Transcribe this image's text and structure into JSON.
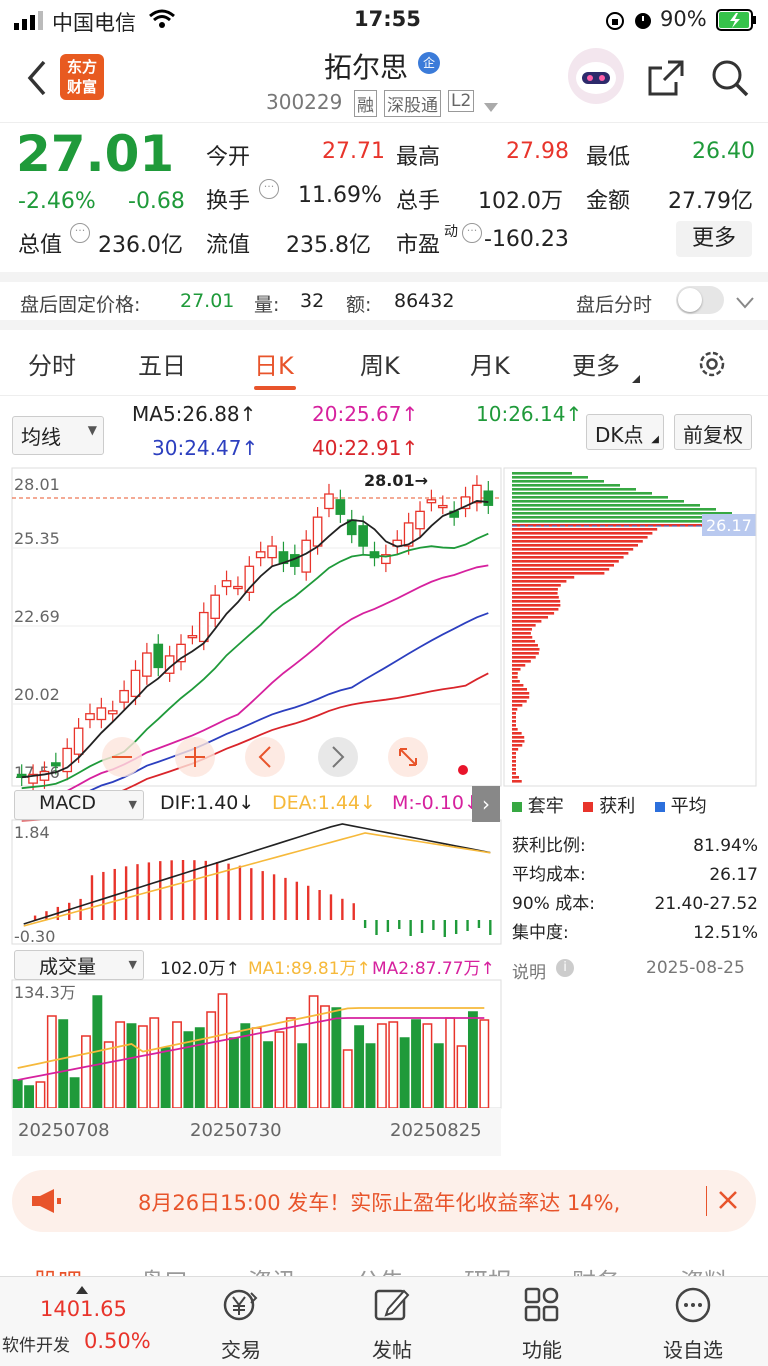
{
  "status": {
    "carrier": "中国电信",
    "time": "17:55",
    "battery": "90%"
  },
  "header": {
    "name": "拓尔思",
    "badge": "企",
    "code": "300229",
    "tags": [
      "融",
      "深股通",
      "L2"
    ],
    "logo_line1": "东方",
    "logo_line2": "财富"
  },
  "quote": {
    "price": "27.01",
    "pct": "-2.46%",
    "chg": "-0.68",
    "row1": [
      {
        "label": "今开",
        "value": "27.71",
        "color": "red"
      },
      {
        "label": "最高",
        "value": "27.98",
        "color": "red"
      },
      {
        "label": "最低",
        "value": "26.40",
        "color": "green"
      }
    ],
    "row2": [
      {
        "label": "换手",
        "value": "11.69%"
      },
      {
        "label": "总手",
        "value": "102.0万"
      },
      {
        "label": "金额",
        "value": "27.79亿"
      }
    ],
    "row3_total_label": "总值",
    "row3_total_value": "236.0亿",
    "row3_float_label": "流值",
    "row3_float_value": "235.8亿",
    "row3_pe_label": "市盈",
    "row3_pe_sup": "动",
    "row3_pe_value": "-160.23",
    "more": "更多"
  },
  "afterhours": {
    "label": "盘后固定价格:",
    "price": "27.01",
    "vol_label": "量:",
    "vol": "32",
    "amt_label": "额:",
    "amt": "86432",
    "toggle_label": "盘后分时"
  },
  "tabs": [
    "分时",
    "五日",
    "日K",
    "周K",
    "月K",
    "更多"
  ],
  "active_tab": 2,
  "ma": {
    "selector": "均线",
    "ma5": "MA5:26.88↑",
    "ma10": "10:26.14↑",
    "ma20": "20:25.67↑",
    "ma30": "30:24.47↑",
    "ma40": "40:22.91↑",
    "dk": "DK点",
    "adjust": "前复权"
  },
  "kchart": {
    "axis": [
      "28.01",
      "25.35",
      "22.69",
      "20.02",
      "17.56"
    ],
    "hi_label": "28.01→",
    "low_label": "17.56",
    "cost_label": "26.17"
  },
  "macd": {
    "selector": "MACD",
    "dif": "DIF:1.40↓",
    "dea": "DEA:1.44↓",
    "m": "M:-0.10↓",
    "top": "1.84",
    "bottom": "-0.30"
  },
  "volume": {
    "selector": "成交量",
    "vol": "102.0万↑",
    "ma1": "MA1:89.81万↑",
    "ma2": "MA2:87.77万↑",
    "top": "134.3万",
    "dates": [
      "20250708",
      "20250730",
      "20250825"
    ]
  },
  "chips": {
    "legend": [
      "套牢",
      "获利",
      "平均"
    ],
    "rows": [
      {
        "label": "获利比例:",
        "value": "81.94%"
      },
      {
        "label": "平均成本:",
        "value": "26.17"
      },
      {
        "label": "90% 成本:",
        "value": "21.40-27.52"
      },
      {
        "label": "集中度:",
        "value": "12.51%"
      }
    ],
    "note": "说明",
    "date": "2025-08-25"
  },
  "promo": {
    "text": "8月26日15:00 发车！实际止盈年化收益率达 14%,"
  },
  "bottomtabs": [
    "股吧",
    "盘口",
    "资讯",
    "公告",
    "研报",
    "财务",
    "资料"
  ],
  "nav": {
    "index_value": "1401.65",
    "index_name": "软件开发",
    "index_pct": "0.50%",
    "items": [
      "交易",
      "发帖",
      "功能",
      "设自选"
    ]
  },
  "colors": {
    "up": "#e8342b",
    "down": "#1f9a3a",
    "accent": "#e8542b"
  }
}
